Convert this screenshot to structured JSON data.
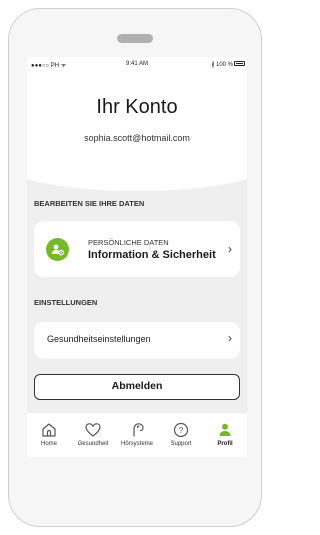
{
  "status_bar": {
    "carrier": "●●●○○ PH ᯤ",
    "time": "9:41 AM",
    "battery": "∦ 100 %"
  },
  "header": {
    "title": "Ihr Konto",
    "email": "sophia.scott@hotmail.com"
  },
  "sections": {
    "edit_label": "BEARBEITEN SIE IHRE DATEN",
    "personal": {
      "subtitle": "PERSÖNLICHE DATEN",
      "title": "Information & Sicherheit",
      "icon": "user-settings-icon"
    },
    "settings_label": "EINSTELLUNGEN",
    "health_settings": "Gesundheitseinstellungen"
  },
  "logout_label": "Abmelden",
  "tabbar": [
    {
      "label": "Home",
      "icon": "home-icon"
    },
    {
      "label": "Gesundheit",
      "icon": "heart-icon"
    },
    {
      "label": "Hörsysteme",
      "icon": "hearing-aid-icon"
    },
    {
      "label": "Support",
      "icon": "help-icon"
    },
    {
      "label": "Profil",
      "icon": "profile-icon"
    }
  ],
  "colors": {
    "accent": "#76b82a",
    "text": "#1a1a1a",
    "background": "#efefef"
  }
}
